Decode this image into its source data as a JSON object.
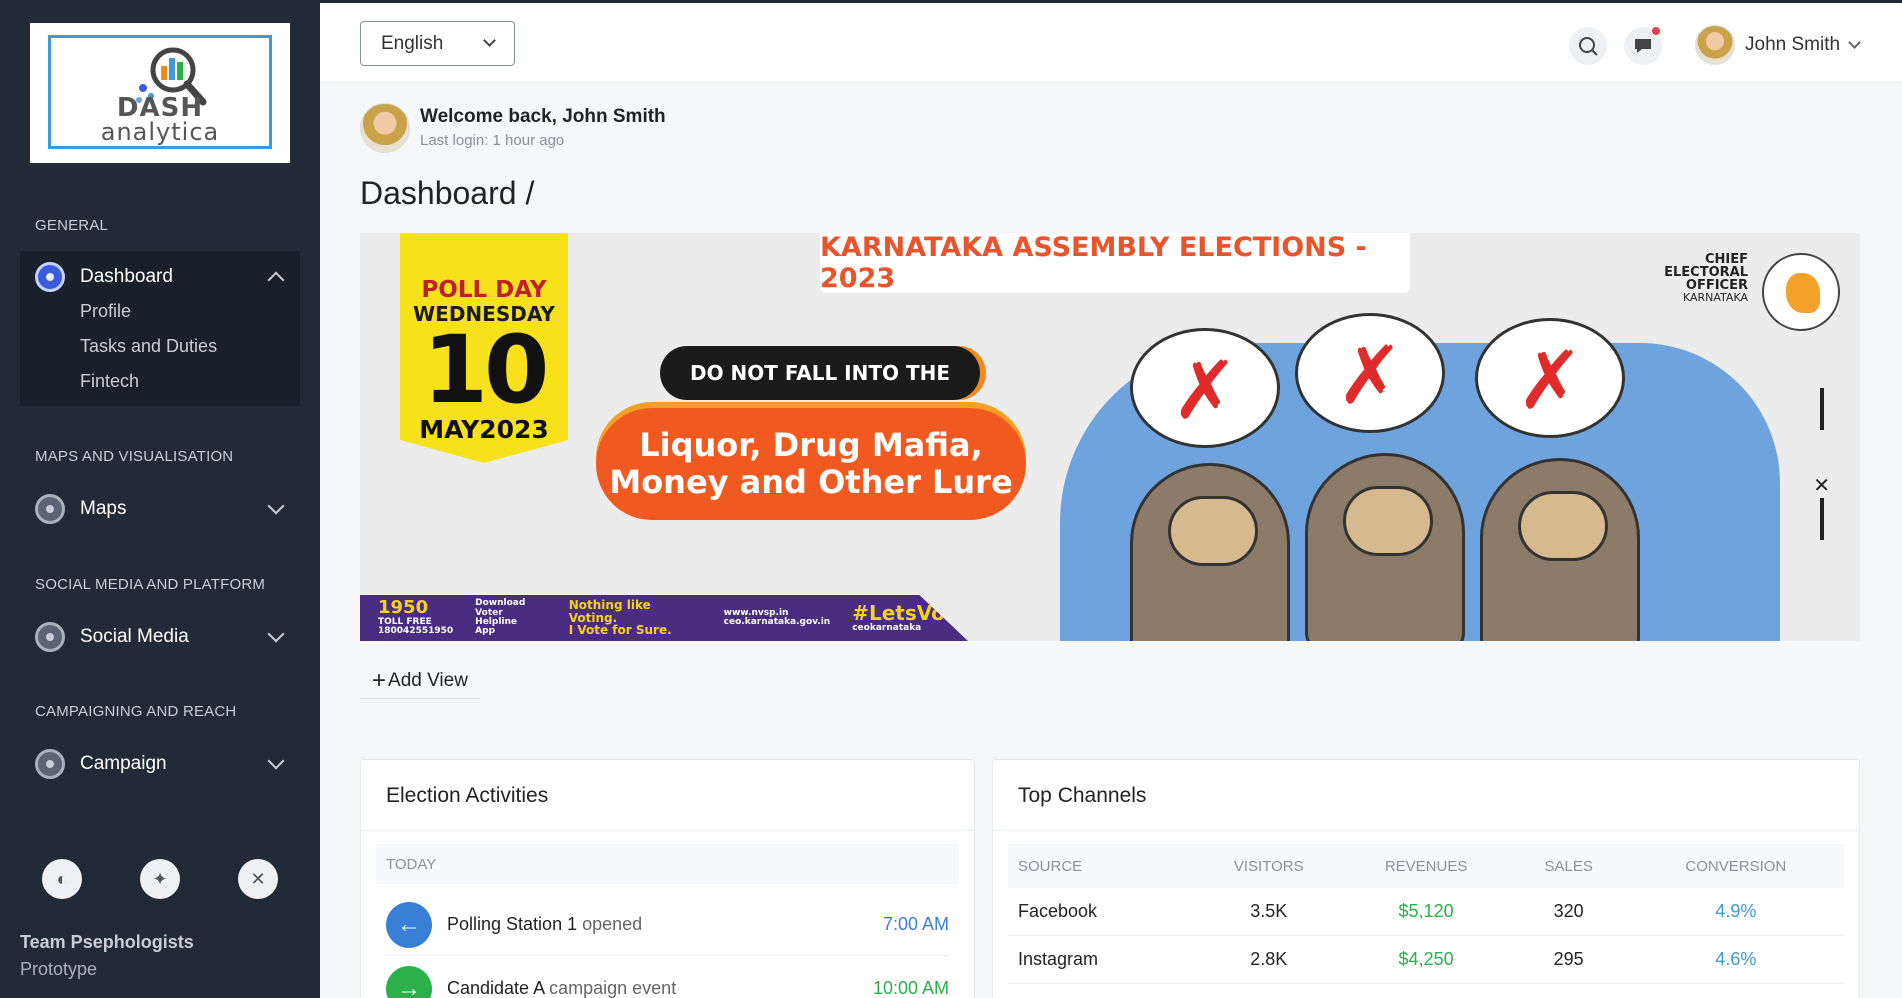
{
  "sidebar": {
    "logo": {
      "line1": "DASH",
      "line2": "analytica"
    },
    "sections": {
      "general": "GENERAL",
      "maps": "MAPS AND VISUALISATION",
      "social": "SOCIAL MEDIA AND PLATFORM",
      "campaign": "CAMPAIGNING AND REACH"
    },
    "dashboard": {
      "label": "Dashboard",
      "sub_items": [
        "Profile",
        "Tasks and Duties",
        "Fintech"
      ]
    },
    "maps_label": "Maps",
    "social_label": "Social Media",
    "campaign_label": "Campaign",
    "tools": [
      "palette-icon",
      "sparkle-icon",
      "close-icon"
    ],
    "team": {
      "name": "Team Psephologists",
      "sub": "Prototype"
    }
  },
  "topbar": {
    "language": "English",
    "icons": [
      "search-icon",
      "chat-icon"
    ],
    "user_name": "John Smith"
  },
  "welcome": {
    "title": "Welcome back, John Smith",
    "last_login": "Last login: 1 hour ago"
  },
  "page_title": "Dashboard /",
  "banner": {
    "title": "KARNATAKA ASSEMBLY ELECTIONS - 2023",
    "poll_day": "POLL DAY",
    "weekday": "WEDNESDAY",
    "date": "10",
    "month_year": "MAY2023",
    "tagline_top": "DO NOT FALL INTO THE",
    "tagline_main": "Liquor, Drug Mafia, Money and Other Lure",
    "ceo_line1": "CHIEF",
    "ceo_line2": "ELECTORAL",
    "ceo_line3": "OFFICER",
    "ceo_line4": "KARNATAKA",
    "footer": {
      "helpline": "1950",
      "toll_free": "TOLL FREE",
      "toll_number": "180042551950",
      "download1": "Download",
      "download2": "Voter Helpline",
      "download3": "App",
      "slogan1": "Nothing like Voting.",
      "slogan2": "I Vote for Sure.",
      "site1": "www.nvsp.in",
      "site2": "ceo.karnataka.gov.in",
      "hashtag": "#LetsVote",
      "handle": "ceokarnataka"
    }
  },
  "add_view_label": "Add View",
  "election_activities": {
    "title": "Election Activities",
    "today_label": "TODAY",
    "items": [
      {
        "title": "Polling Station 1",
        "suffix": "opened",
        "time": "7:00 AM",
        "color": "#3a7fd6"
      },
      {
        "title": "Candidate A",
        "suffix": "campaign event",
        "time": "10:00 AM",
        "color": "#2bb04a"
      }
    ]
  },
  "top_channels": {
    "title": "Top Channels",
    "headers": [
      "SOURCE",
      "VISITORS",
      "REVENUES",
      "SALES",
      "CONVERSION"
    ],
    "rows": [
      {
        "source": "Facebook",
        "visitors": "3.5K",
        "revenues": "$5,120",
        "sales": "320",
        "conversion": "4.9%"
      },
      {
        "source": "Instagram",
        "visitors": "2.8K",
        "revenues": "$4,250",
        "sales": "295",
        "conversion": "4.6%"
      }
    ]
  },
  "colors": {
    "sidebar_bg": "#212a37",
    "accent_blue": "#3a7fd6",
    "accent_green": "#2bb04a",
    "banner_orange": "#f05a20"
  }
}
